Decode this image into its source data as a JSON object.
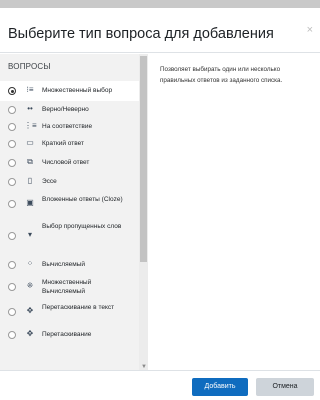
{
  "dialog": {
    "title": "Выберите тип вопроса для добавления",
    "close_icon": "×"
  },
  "left_panel": {
    "section_title": "ВОПРОСЫ",
    "items": [
      {
        "label": "Множественный выбор",
        "icon": "⁝≡",
        "icon_name": "multichoice-icon",
        "selected": true
      },
      {
        "label": "Верно/Неверно",
        "icon": "••",
        "icon_name": "truefalse-icon",
        "selected": false
      },
      {
        "label": "На соответствие",
        "icon": "⋮≡",
        "icon_name": "match-icon",
        "selected": false
      },
      {
        "label": "Краткий ответ",
        "icon": "▭",
        "icon_name": "shortanswer-icon",
        "selected": false
      },
      {
        "label": "Числовой ответ",
        "icon": "⧉",
        "icon_name": "numerical-icon",
        "selected": false
      },
      {
        "label": "Эссе",
        "icon": "▯",
        "icon_name": "essay-icon",
        "selected": false
      },
      {
        "label": "Вложенные ответы (Cloze)",
        "icon": "▣",
        "icon_name": "cloze-icon",
        "selected": false
      },
      {
        "label": "Выбор пропущенных слов",
        "icon": "▾",
        "icon_name": "gapselect-icon",
        "selected": false
      },
      {
        "label": "Вычисляемый",
        "icon": "⁘",
        "icon_name": "calculated-icon",
        "selected": false
      },
      {
        "label": "Множественный Вычисляемый",
        "icon": "⁜",
        "icon_name": "calculatedmulti-icon",
        "selected": false
      },
      {
        "label": "Перетаскивание в текст",
        "icon": "✥",
        "icon_name": "ddwtos-icon",
        "selected": false
      },
      {
        "label": "Перетаскивание",
        "icon": "✥",
        "icon_name": "ddimageortext-icon",
        "selected": false
      }
    ]
  },
  "right_panel": {
    "description": "Позволяет выбирать один или несколько правильных ответов из заданного списка."
  },
  "footer": {
    "add_label": "Добавить",
    "cancel_label": "Отмена"
  },
  "colors": {
    "primary": "#0f6cbf",
    "panel_bg": "#f2f2f2"
  }
}
